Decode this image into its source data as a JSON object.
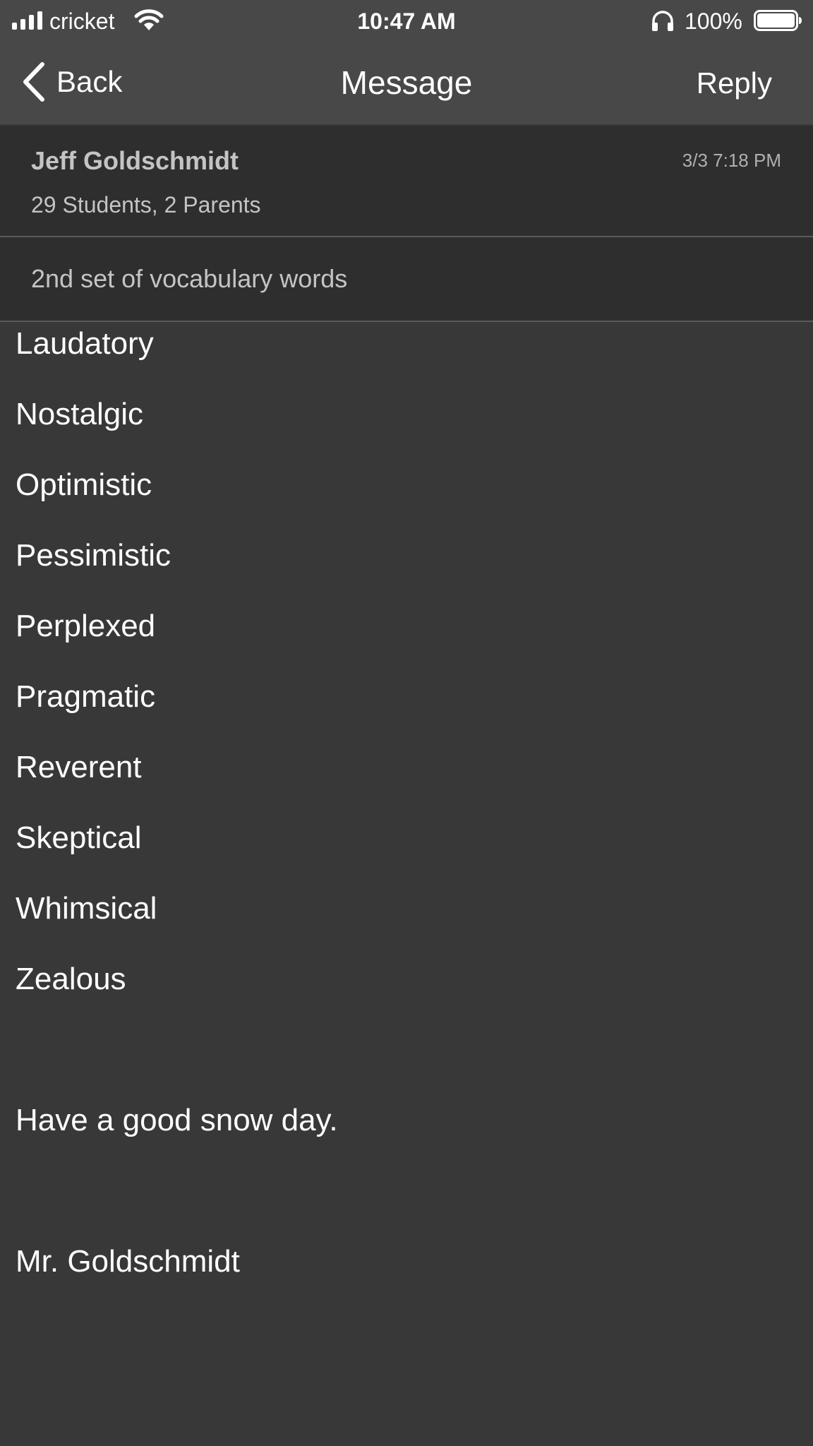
{
  "status_bar": {
    "carrier": "cricket",
    "time": "10:47 AM",
    "battery_percent": "100%",
    "battery_level": 1.0,
    "icons": [
      "signal-icon",
      "wifi-icon",
      "headphones-icon",
      "battery-icon"
    ]
  },
  "nav": {
    "back_label": "Back",
    "title": "Message",
    "reply_label": "Reply"
  },
  "message": {
    "sender": "Jeff Goldschmidt",
    "timestamp": "3/3 7:18 PM",
    "recipients": "29 Students, 2 Parents",
    "subject": "2nd set of vocabulary words",
    "words": [
      "Laudatory",
      "Nostalgic",
      "Optimistic",
      "Pessimistic",
      "Perplexed",
      "Pragmatic",
      "Reverent",
      "Skeptical",
      "Whimsical",
      "Zealous"
    ],
    "closing": "Have a good snow day.",
    "signature": "Mr. Goldschmidt"
  },
  "colors": {
    "nav_background": "#484848",
    "header_background": "#2e2e2e",
    "body_background": "#383838",
    "divider": "#5a5a5a",
    "text_primary": "#ffffff",
    "text_secondary": "#c4c4c4"
  }
}
